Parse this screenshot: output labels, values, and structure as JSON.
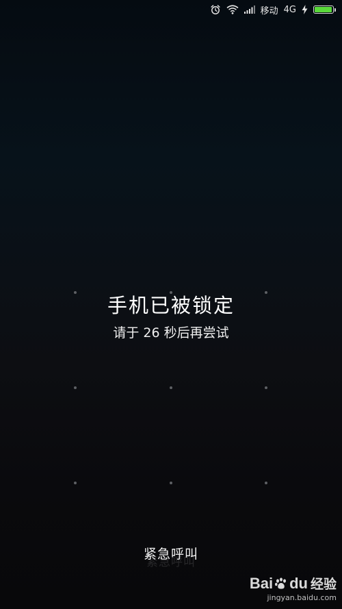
{
  "status_bar": {
    "carrier": "移动",
    "network": "4G",
    "battery_level": 0.95,
    "icons": [
      "alarm-icon",
      "wifi-icon",
      "signal-icon",
      "charging-icon",
      "battery-icon"
    ],
    "battery_color": "#59d93a"
  },
  "lock": {
    "title": "手机已被锁定",
    "subtitle": "请于 26 秒后再尝试"
  },
  "emergency": {
    "label": "紧急呼叫"
  },
  "watermark": {
    "brand_prefix": "Bai",
    "brand_suffix": "du",
    "brand_cn": "经验",
    "url": "jingyan.baidu.com"
  }
}
